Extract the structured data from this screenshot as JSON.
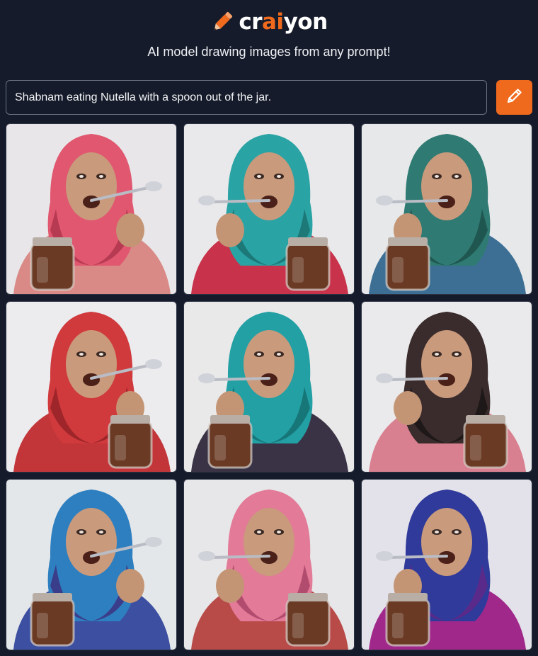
{
  "header": {
    "logo_text_pre": "cr",
    "logo_text_accent": "ai",
    "logo_text_post": "yon",
    "logo_icon": "pencil-icon",
    "tagline": "AI model drawing images from any prompt!"
  },
  "prompt": {
    "value": "Shabnam eating Nutella with a spoon out of the jar.",
    "draw_button_icon": "pencil-icon"
  },
  "colors": {
    "background": "#151b2a",
    "accent": "#f06a1e",
    "input_border": "#6b7384"
  },
  "results": [
    {
      "scarf": "#e0576f",
      "scarf_dark": "#b63a52",
      "clothing": "#d98a86",
      "bg": "#e8e6e9"
    },
    {
      "scarf": "#2aa3a4",
      "scarf_dark": "#1d7878",
      "clothing": "#c8324a",
      "bg": "#e9e9eb"
    },
    {
      "scarf": "#2f7a72",
      "scarf_dark": "#1f5650",
      "clothing": "#3d6f95",
      "bg": "#e6e8ea"
    },
    {
      "scarf": "#d03a3d",
      "scarf_dark": "#9e2529",
      "clothing": "#c2363a",
      "bg": "#ecebee"
    },
    {
      "scarf": "#23a0a4",
      "scarf_dark": "#167678",
      "clothing": "#3a3346",
      "bg": "#e9e9ea"
    },
    {
      "scarf": "#3a2c2c",
      "scarf_dark": "#1f1818",
      "clothing": "#d98090",
      "bg": "#eaeaec"
    },
    {
      "scarf": "#2e7fc0",
      "scarf_dark": "#3a3e8a",
      "clothing": "#3c4fa0",
      "bg": "#e4e7ea"
    },
    {
      "scarf": "#e27a98",
      "scarf_dark": "#b24c6e",
      "clothing": "#b84a48",
      "bg": "#e7e6e8"
    },
    {
      "scarf": "#2f3a9a",
      "scarf_dark": "#5a2a8a",
      "clothing": "#a0288a",
      "bg": "#e3e2ea"
    }
  ]
}
